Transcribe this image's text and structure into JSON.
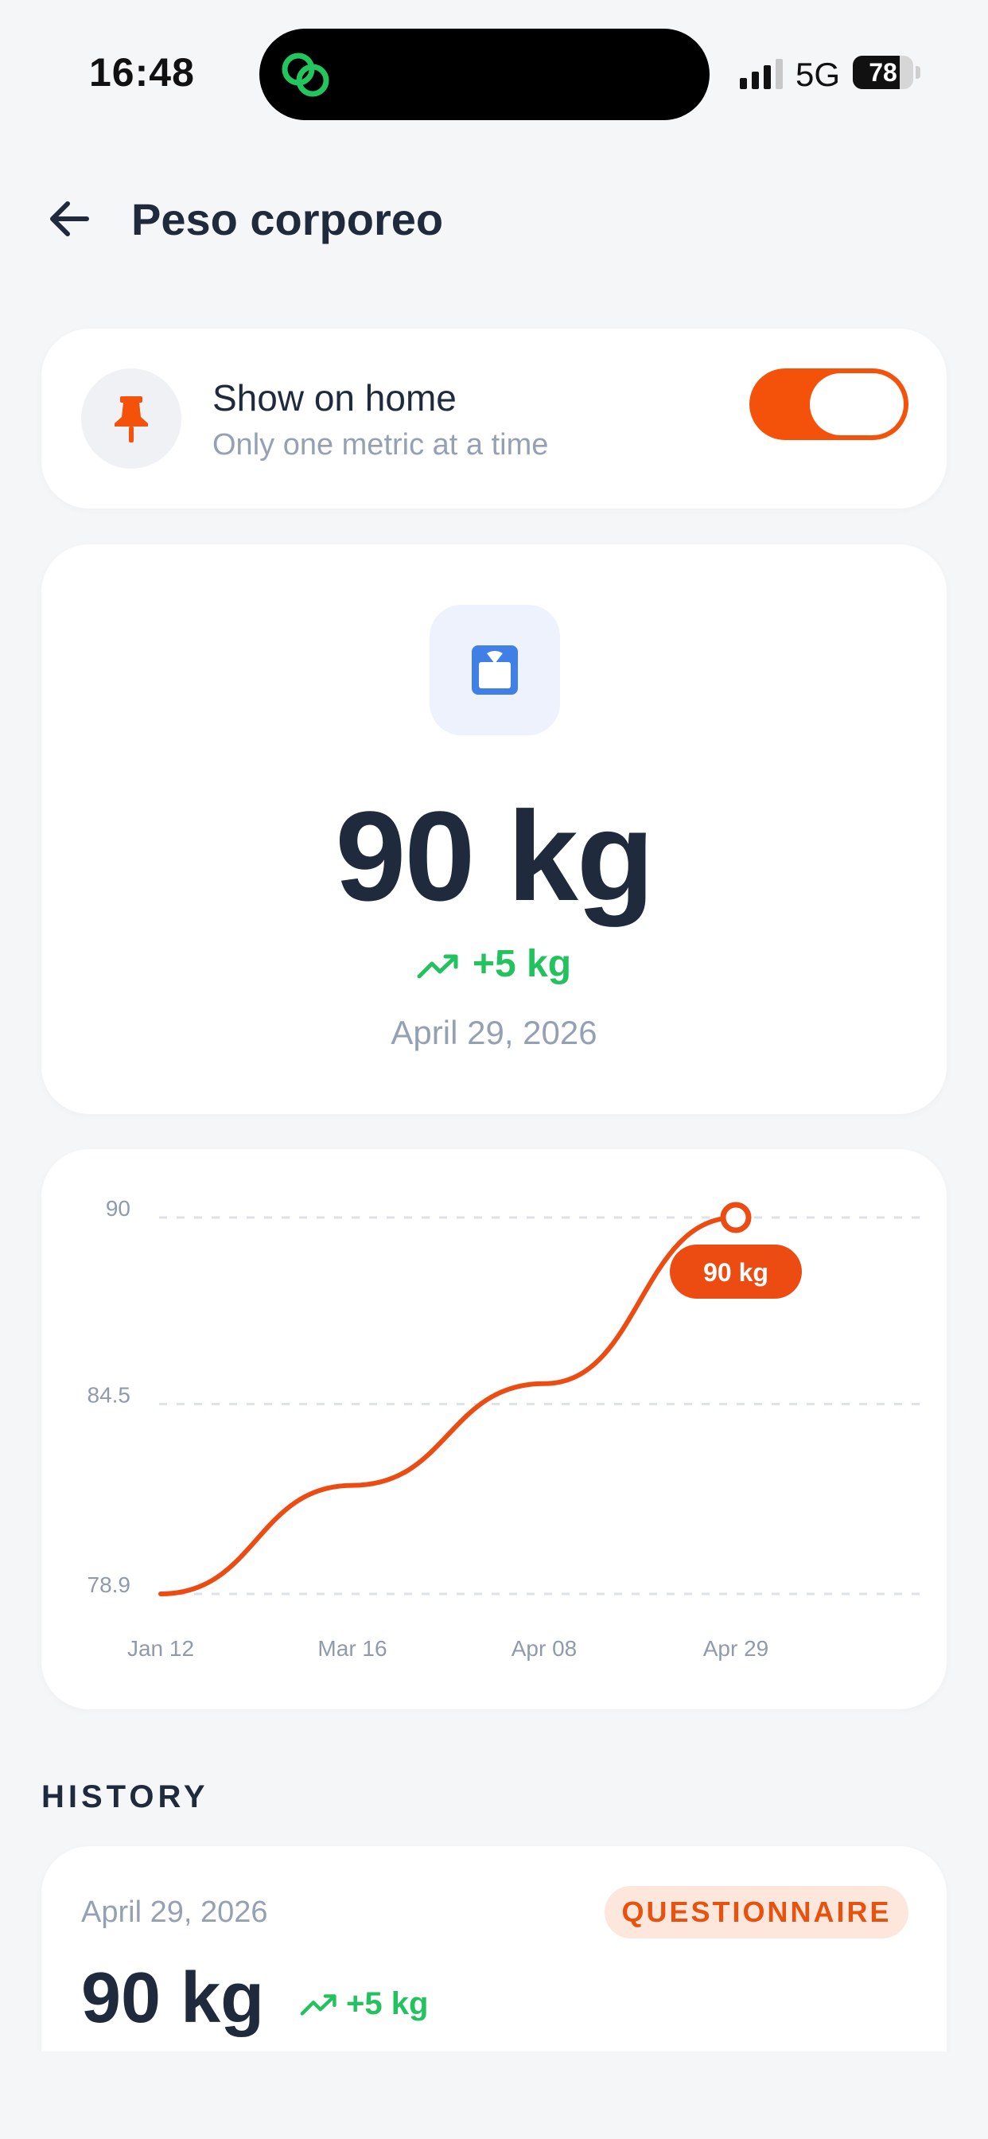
{
  "status_bar": {
    "time": "16:48",
    "network": "5G",
    "battery_level": "78",
    "battery_fraction": 0.78,
    "app_icon": "link-rings-icon",
    "app_icon_color": "#22c55e"
  },
  "header": {
    "title": "Peso corporeo",
    "back_icon": "arrow-left-icon"
  },
  "show_on_home": {
    "title": "Show on home",
    "subtitle": "Only one metric at a time",
    "icon": "pin-icon",
    "enabled": true
  },
  "metric": {
    "icon": "scale-icon",
    "value": "90 kg",
    "delta": "+5 kg",
    "trend_icon": "trending-up-icon",
    "date": "April 29, 2026"
  },
  "chart_data": {
    "type": "line",
    "title": "",
    "xlabel": "",
    "ylabel": "",
    "categories": [
      "Jan 12",
      "Mar 16",
      "Apr 08",
      "Apr 29"
    ],
    "series": [
      {
        "values": [
          78.9,
          82.1,
          85.1,
          90
        ]
      }
    ],
    "yticks": [
      "78.9",
      "84.5",
      "90"
    ],
    "ylim": [
      78.9,
      90
    ],
    "grid": true,
    "highlight": {
      "index": 3,
      "label": "90 kg"
    },
    "line_color": "#ec4c12"
  },
  "history": {
    "section_title": "HISTORY",
    "entries": [
      {
        "date": "April 29, 2026",
        "source": "QUESTIONNAIRE",
        "value": "90 kg",
        "delta": "+5 kg"
      }
    ]
  },
  "colors": {
    "accent": "#f4520a",
    "positive": "#22c25e",
    "text": "#1f2a3c",
    "muted": "#95a1b3",
    "background": "#f5f6f8"
  }
}
